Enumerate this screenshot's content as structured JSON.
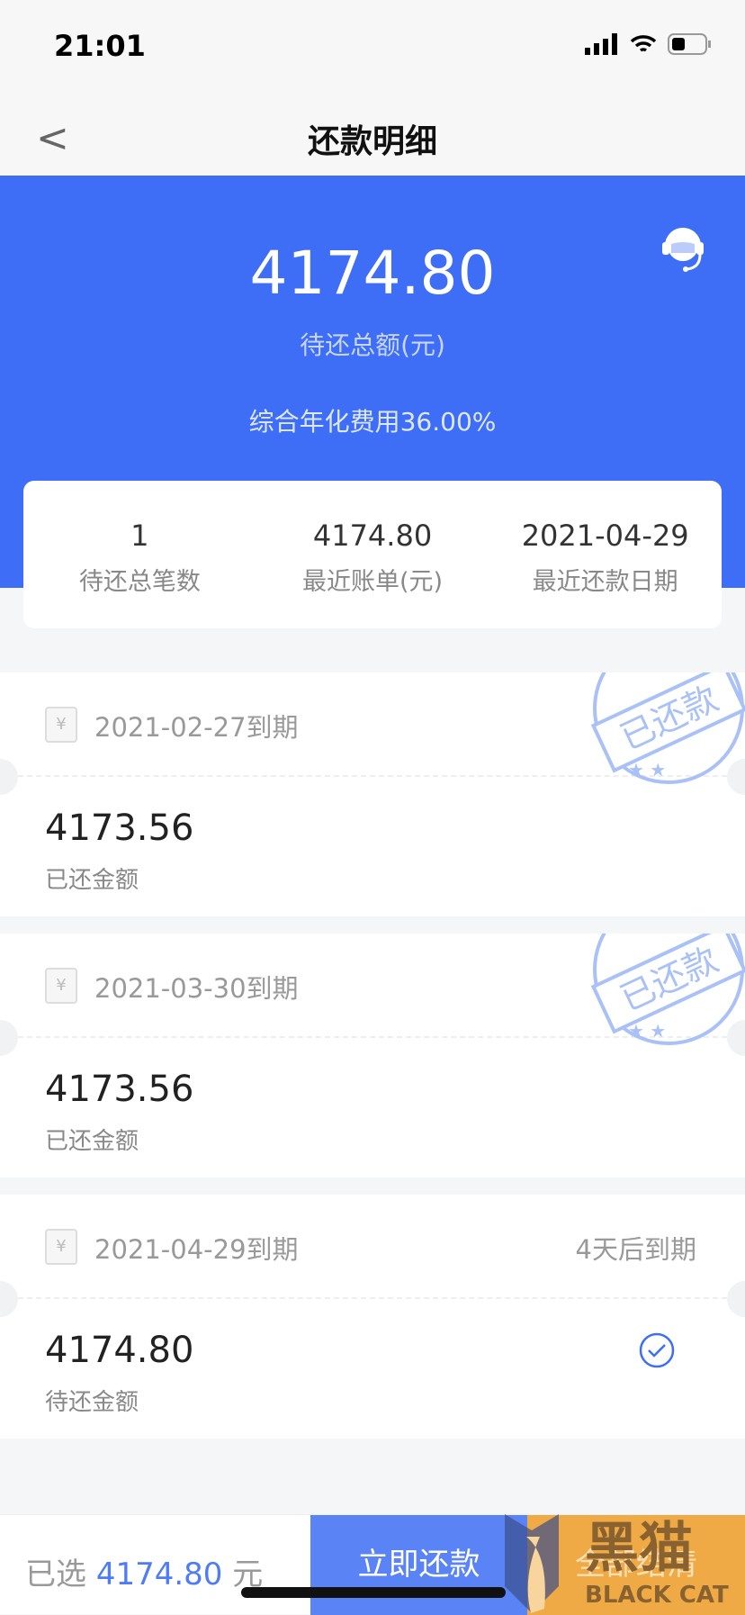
{
  "status": {
    "time": "21:01"
  },
  "nav": {
    "title": "还款明细"
  },
  "hero": {
    "amount": "4174.80",
    "amount_label": "待还总额(元)",
    "rate": "综合年化费用36.00%"
  },
  "summary": [
    {
      "value": "1",
      "label": "待还总笔数"
    },
    {
      "value": "4174.80",
      "label": "最近账单(元)"
    },
    {
      "value": "2021-04-29",
      "label": "最近还款日期"
    }
  ],
  "items": [
    {
      "due": "2021-02-27到期",
      "amount": "4173.56",
      "label": "已还金额",
      "stamp": "已还款",
      "remain": ""
    },
    {
      "due": "2021-03-30到期",
      "amount": "4173.56",
      "label": "已还金额",
      "stamp": "已还款",
      "remain": ""
    },
    {
      "due": "2021-04-29到期",
      "amount": "4174.80",
      "label": "待还金额",
      "remain": "4天后到期",
      "selected": true
    }
  ],
  "bottom": {
    "selected_prefix": "已选",
    "selected_amount": "4174.80",
    "selected_unit": "元",
    "pay_label": "立即还款",
    "payoff_label": "全部结清"
  },
  "watermark": {
    "text": "黑猫 BLACK CAT"
  },
  "colors": {
    "primary": "#3d6ef5",
    "stamp": "#9db8f5"
  }
}
